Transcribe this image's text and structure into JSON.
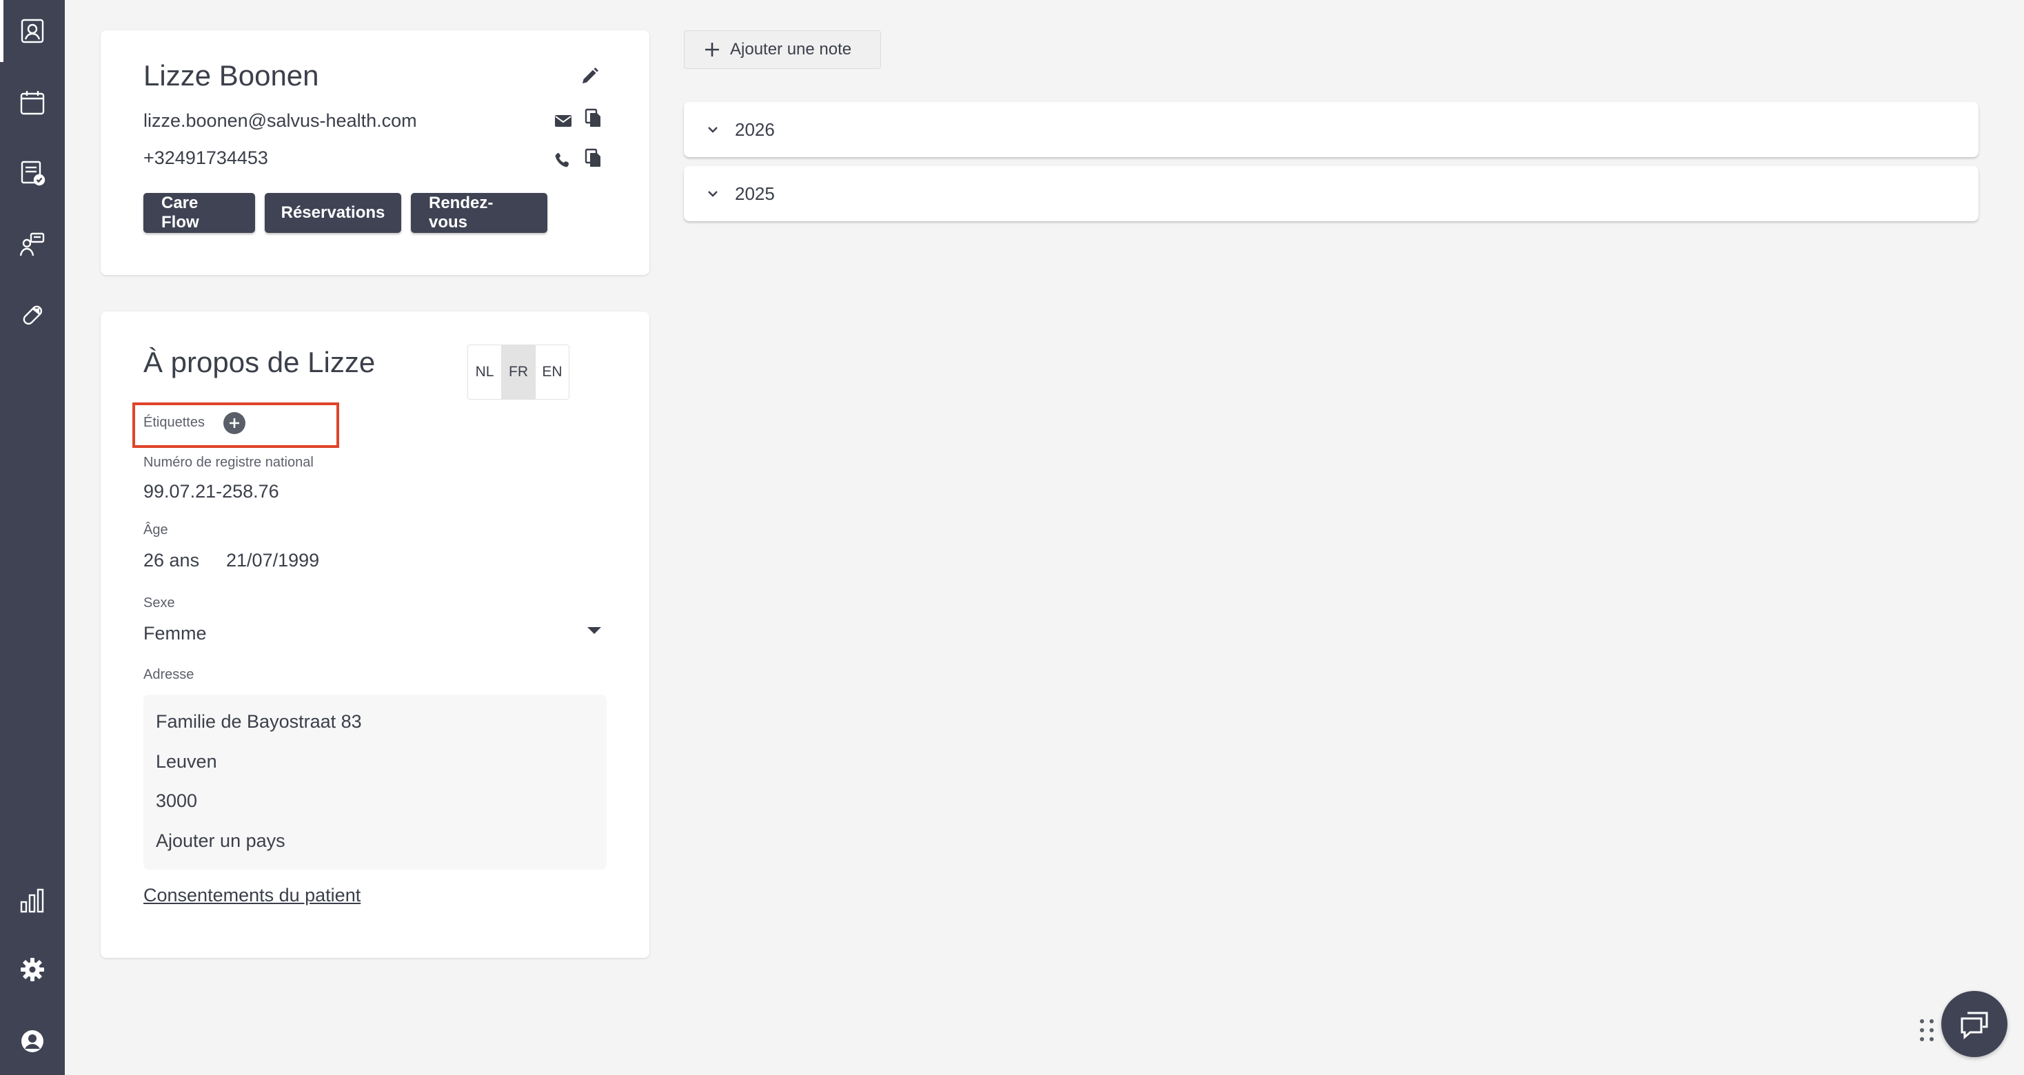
{
  "sidebar": {
    "items": [
      {
        "icon": "contact-card-icon"
      },
      {
        "icon": "calendar-icon"
      },
      {
        "icon": "checked-document-icon"
      },
      {
        "icon": "person-chat-icon"
      },
      {
        "icon": "pill-icon"
      },
      {
        "icon": "bar-chart-icon"
      },
      {
        "icon": "gear-icon"
      },
      {
        "icon": "user-circle-icon"
      }
    ],
    "colors": {
      "background": "#3f4354",
      "icon": "#ffffff"
    }
  },
  "contact": {
    "name": "Lizze Boonen",
    "email": "lizze.boonen@salvus-health.com",
    "phone": "+32491734453",
    "buttons": {
      "care_flow": "Care Flow",
      "reservations": "Réservations",
      "appointments": "Rendez-vous"
    }
  },
  "about": {
    "title": "À propos de Lizze",
    "languages": [
      "NL",
      "FR",
      "EN"
    ],
    "selected_language": "FR",
    "tags_label": "Étiquettes",
    "national_register": {
      "label": "Numéro de registre national",
      "value": "99.07.21-258.76"
    },
    "age": {
      "label": "Âge",
      "value": "26 ans",
      "birthdate": "21/07/1999"
    },
    "sex": {
      "label": "Sexe",
      "value": "Femme"
    },
    "address": {
      "label": "Adresse",
      "street": "Familie de Bayostraat 83",
      "city": "Leuven",
      "postal_code": "3000",
      "country_placeholder": "Ajouter un pays"
    },
    "consents_link": "Consentements du patient"
  },
  "notes": {
    "add_note_label": "Ajouter une note",
    "years": [
      "2026",
      "2025"
    ]
  },
  "colors": {
    "accent_dark": "#3f4354",
    "highlight_border": "#e0442a",
    "page_background": "#f4f4f4"
  }
}
